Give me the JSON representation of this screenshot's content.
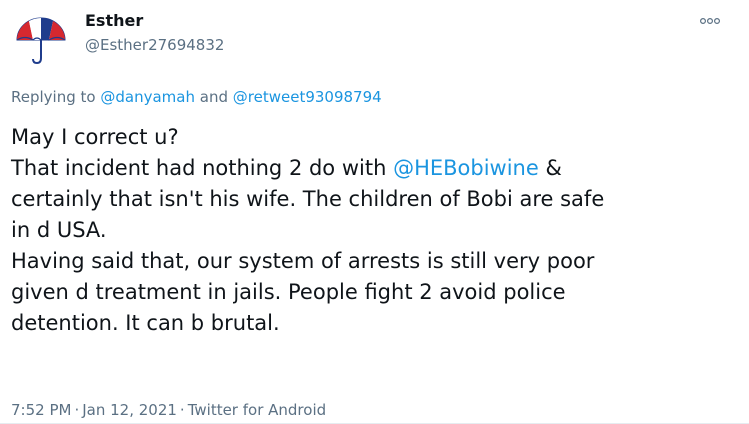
{
  "author": {
    "display_name": "Esther",
    "handle": "@Esther27694832",
    "avatar_icon": "red-white-blue-umbrella-icon"
  },
  "more_icon": "more-options-icon",
  "replying": {
    "prefix": "Replying to",
    "mention_1": "@danyamah",
    "conjunction": "and",
    "mention_2": "@retweet93098794"
  },
  "body": {
    "line_1": "May I correct u?",
    "line_2_before": "That incident had nothing 2 do with ",
    "line_2_mention": "@HEBobiwine",
    "line_2_after": " &",
    "line_3": "certainly that isn't his wife. The children of Bobi are safe",
    "line_4": "in d USA.",
    "line_5": "Having said that, our system of arrests is still very poor",
    "line_6": "given d treatment in jails. People fight 2 avoid police",
    "line_7": "detention. It can b brutal."
  },
  "meta": {
    "time": "7:52 PM",
    "separator": "·",
    "date": "Jan 12, 2021",
    "source": "Twitter for Android"
  },
  "colors": {
    "link": "#1b95e0",
    "secondary_text": "#5b7083",
    "primary_text": "#0f1419",
    "umbrella_red": "#d6282f",
    "umbrella_blue": "#1f3c8c"
  }
}
